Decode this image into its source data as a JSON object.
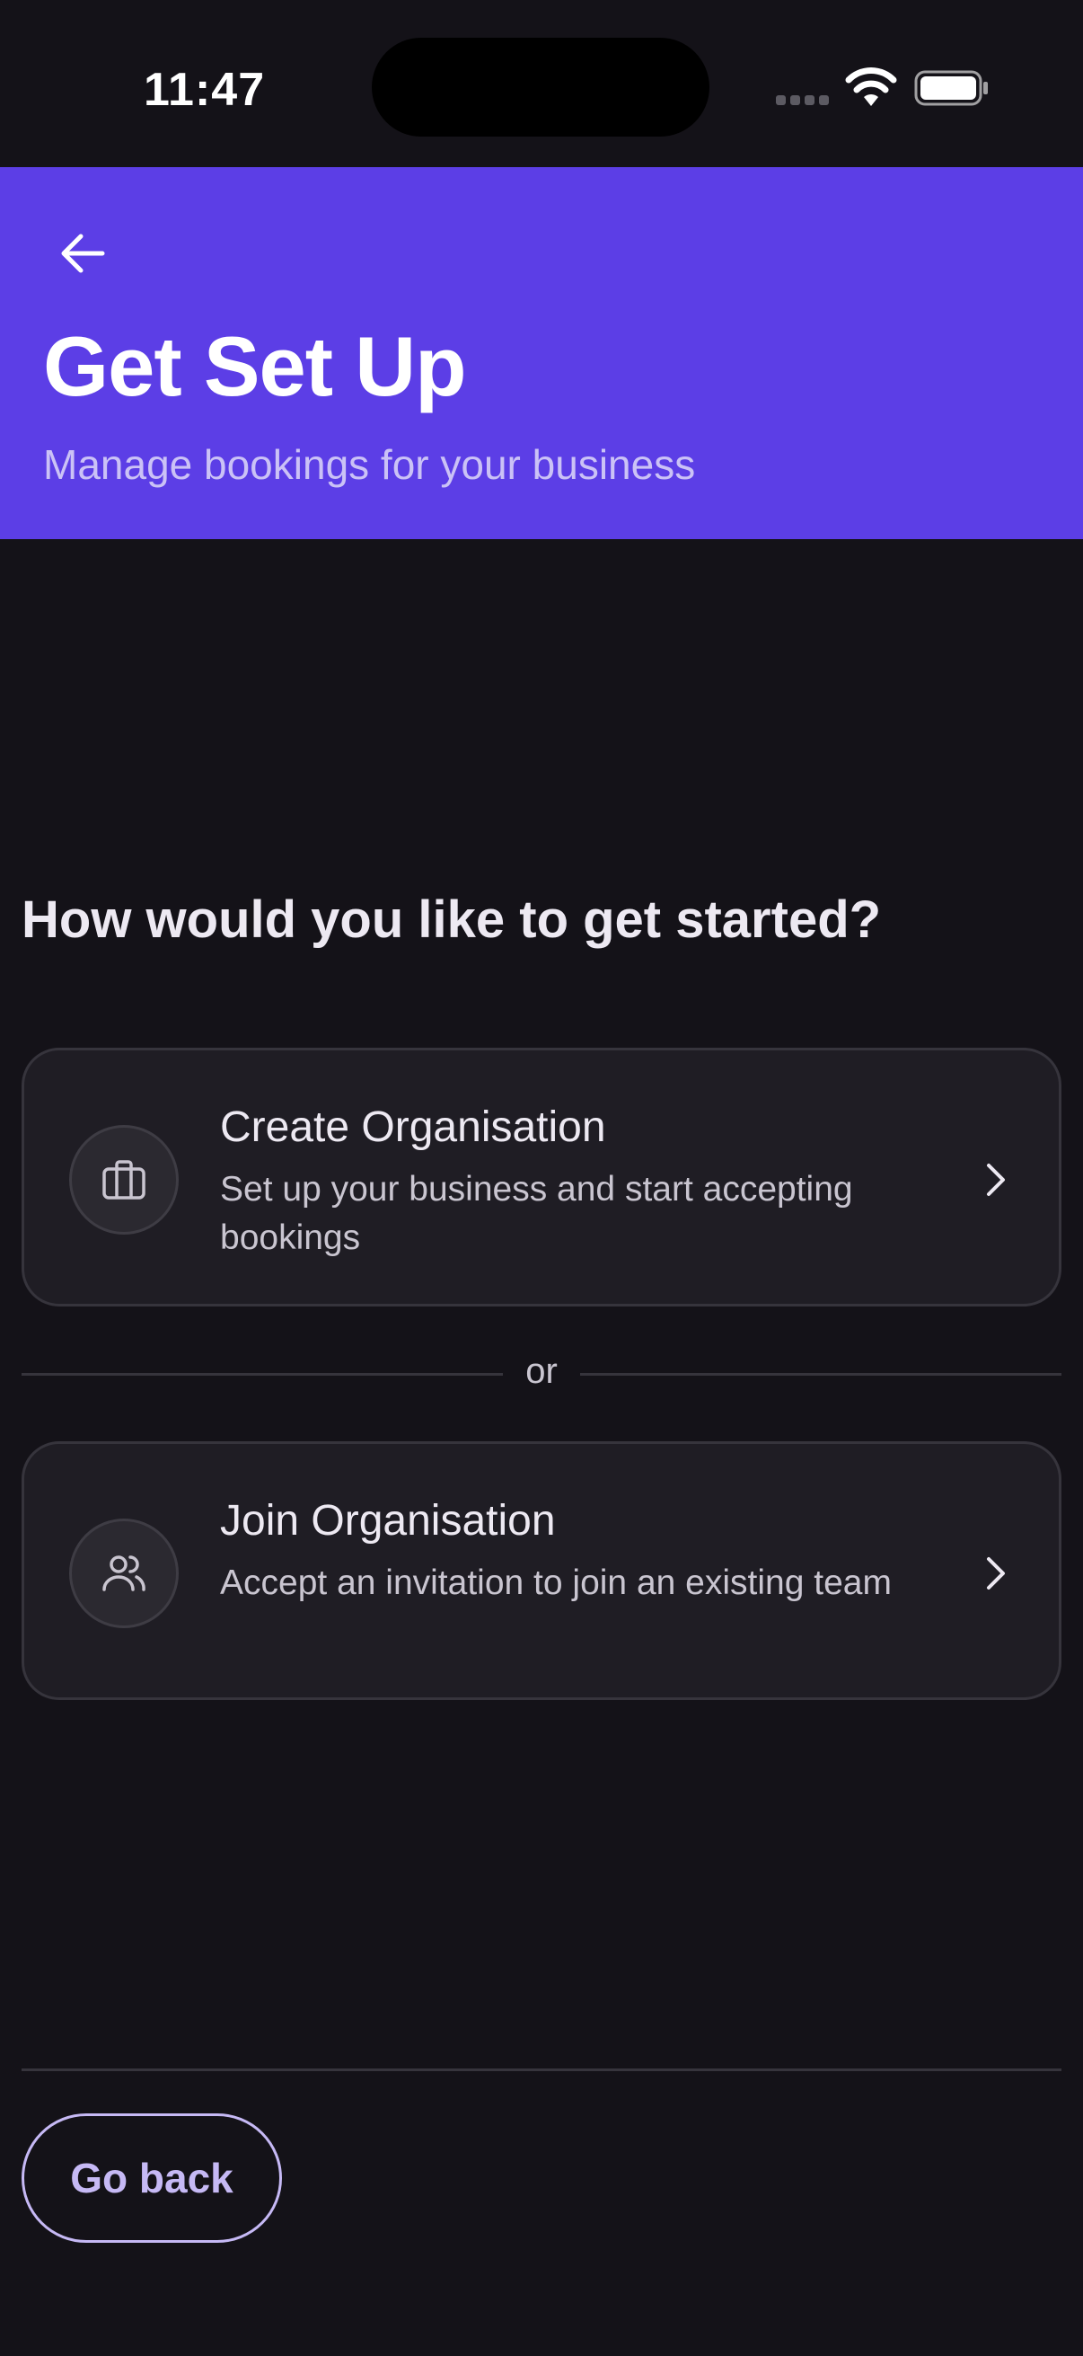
{
  "status_bar": {
    "time": "11:47",
    "icons": [
      "signal-dots-icon",
      "wifi-icon",
      "battery-icon"
    ]
  },
  "header": {
    "back_icon": "arrow-left-icon",
    "title": "Get Set Up",
    "subtitle": "Manage bookings for your business"
  },
  "main": {
    "question": "How would you like to get started?",
    "options": [
      {
        "icon": "briefcase-icon",
        "title": "Create Organisation",
        "description": "Set up your business and start accepting bookings"
      },
      {
        "icon": "users-icon",
        "title": "Join Organisation",
        "description": "Accept an invitation to join an existing team"
      }
    ],
    "divider_text": "or"
  },
  "footer": {
    "go_back_label": "Go back"
  },
  "colors": {
    "background": "#141218",
    "header": "#5c3ee6",
    "card": "#1f1d24",
    "accent_outline": "#c6b9f5"
  }
}
